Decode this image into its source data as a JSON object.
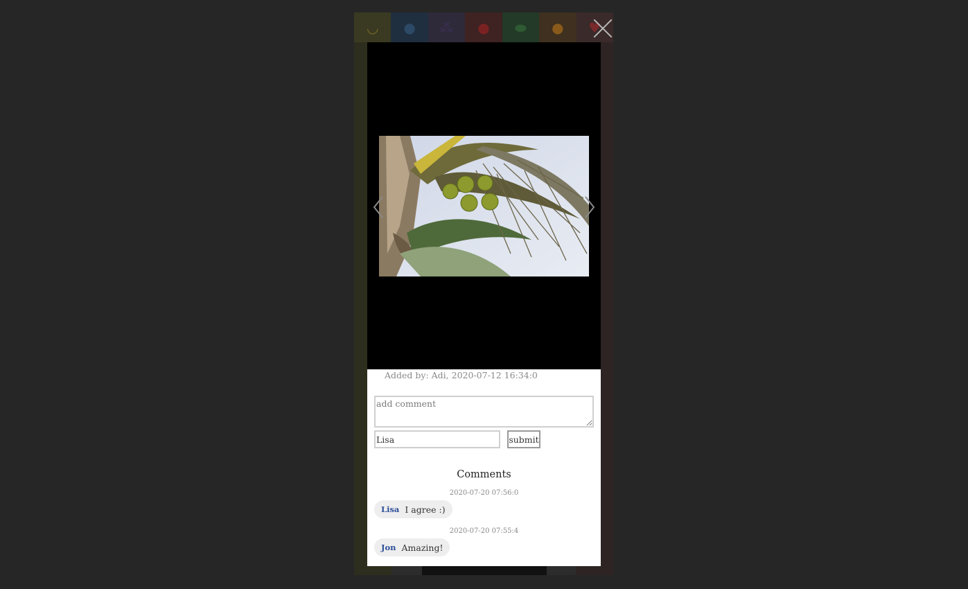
{
  "fruit_tabs": [
    {
      "icon": "banana-icon",
      "glyph": "◡"
    },
    {
      "icon": "blueberry-icon",
      "glyph": "●"
    },
    {
      "icon": "grapes-icon",
      "glyph": "⁂"
    },
    {
      "icon": "apple-icon",
      "glyph": "●"
    },
    {
      "icon": "avocado-icon",
      "glyph": "⬬"
    },
    {
      "icon": "orange-icon",
      "glyph": "●"
    },
    {
      "icon": "strawberry-icon",
      "glyph": "♥"
    }
  ],
  "photo": {
    "alt": "coconut-palm-photo"
  },
  "meta": {
    "added_by": "Added by: Adi, 2020-07-12 16:34:0"
  },
  "form": {
    "comment_placeholder": "add comment",
    "name_value": "Lisa",
    "submit_label": "submit"
  },
  "comments_heading": "Comments",
  "comments": [
    {
      "timestamp": "2020-07-20 07:56:0",
      "author": "Lisa",
      "text": "I agree :)"
    },
    {
      "timestamp": "2020-07-20 07:55:4",
      "author": "Jon",
      "text": "Amazing!"
    }
  ]
}
